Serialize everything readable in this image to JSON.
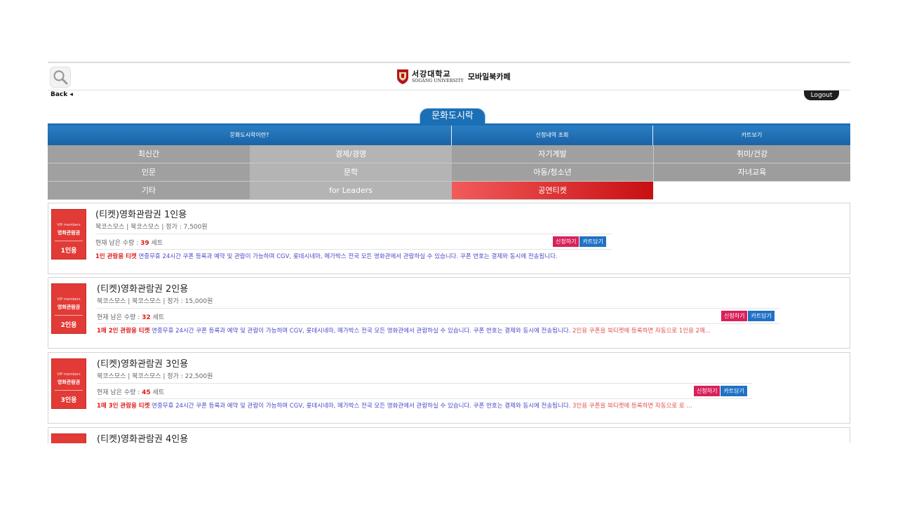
{
  "header": {
    "logo_kr": "서강대학교",
    "logo_en": "SOGANG UNIVERSITY",
    "logo_sub": "모바일북카페",
    "back_label": "Back ◂",
    "logout_label": "Logout"
  },
  "section_title": "문화도시락",
  "menu": {
    "about": "문화도시락이란?",
    "history": "신청내역 조회",
    "cart": "카트보기"
  },
  "categories": {
    "c0": "최신간",
    "c1": "경제/경영",
    "c2": "자기계발",
    "c3": "취미/건강",
    "c4": "인문",
    "c5": "문학",
    "c6": "아동/청소년",
    "c7": "자녀교육",
    "c8": "기타",
    "c9": "for Leaders",
    "c10": "공연티켓"
  },
  "products": [
    {
      "title": "(티켓)영화관람권 1인용",
      "info": "북코스모스 | 북코스모스 | 정가 : 7,500원",
      "stock_label": "현재 남은 수량 : ",
      "stock_num": "39",
      "stock_unit": " 세트",
      "apply_label": "신청하기",
      "cart_label": "카트담기",
      "thumb_top": "VIP members",
      "thumb_mid": "영화관람권",
      "thumb_bottom": "1인용",
      "desc_highlight": "1인 관람용 티켓",
      "desc_text": " 연중무휴 24시간 쿠폰 등록과 예약 및 관람이 가능하며 CGV, 롯데시네마, 메가박스 전국 모든 영화관에서 관람하실 수 있습니다. 쿠폰 번호는 결제와 동시에 전송됩니다.",
      "desc_tail": ""
    },
    {
      "title": "(티켓)영화관람권 2인용",
      "info": "북코스모스 | 북코스모스 | 정가 : 15,000원",
      "stock_label": "현재 남은 수량 : ",
      "stock_num": "32",
      "stock_unit": " 세트",
      "apply_label": "신청하기",
      "cart_label": "카트담기",
      "thumb_top": "VIP members",
      "thumb_mid": "영화관람권",
      "thumb_bottom": "2인용",
      "desc_highlight": "1매 2인 관람용 티켓",
      "desc_text": " 연중무휴 24시간 쿠폰 등록과 예약 및 관람이 가능하며 CGV, 롯데시네마, 메가박스 전국 모든 영화관에서 관람하실 수 있습니다. 쿠폰 번호는 결제와 동시에 전송됩니다.",
      "desc_tail": " 2인용 쿠폰을 북티켓에 등록하면 자동으로 1인용 2매..."
    },
    {
      "title": "(티켓)영화관람권 3인용",
      "info": "북코스모스 | 북코스모스 | 정가 : 22,500원",
      "stock_label": "현재 남은 수량 : ",
      "stock_num": "45",
      "stock_unit": " 세트",
      "apply_label": "신청하기",
      "cart_label": "카트담기",
      "thumb_top": "VIP members",
      "thumb_mid": "영화관람권",
      "thumb_bottom": "3인용",
      "desc_highlight": "1매 3인 관람용 티켓",
      "desc_text": " 연중무휴 24시간 쿠폰 등록과 예약 및 관람이 가능하며 CGV, 롯데시네마, 메가박스 전국 모든 영화관에서 관람하실 수 있습니다. 쿠폰 번호는 결제와 동시에 전송됩니다.",
      "desc_tail": " 3인용 쿠폰을 북티켓에 등록하면 자동으로 로 ..."
    },
    {
      "title": "(티켓)영화관람권 4인용"
    }
  ]
}
